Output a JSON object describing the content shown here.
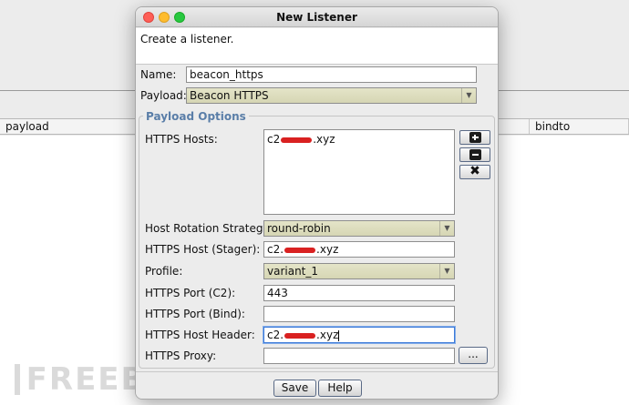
{
  "background": {
    "table": {
      "columns": [
        "payload",
        "bindto"
      ]
    },
    "watermark": "FREEBUF"
  },
  "dialog": {
    "title": "New Listener",
    "description": "Create a listener.",
    "name": {
      "label": "Name:",
      "value": "beacon_https"
    },
    "payload": {
      "label": "Payload:",
      "value": "Beacon HTTPS"
    },
    "group_title": "Payload Options",
    "hosts": {
      "label": "HTTPS Hosts:",
      "items": [
        {
          "prefix": "c2",
          "suffix": ".xyz"
        }
      ],
      "add_button": "add-icon",
      "remove_button": "remove-icon",
      "clear_button": "clear-icon"
    },
    "rotation": {
      "label": "Host Rotation Strategy:",
      "value": "round-robin"
    },
    "stager_host": {
      "label": "HTTPS Host (Stager):",
      "prefix": "c2.",
      "suffix": ".xyz"
    },
    "profile": {
      "label": "Profile:",
      "value": "variant_1"
    },
    "port_c2": {
      "label": "HTTPS Port (C2):",
      "value": "443"
    },
    "port_bind": {
      "label": "HTTPS Port (Bind):",
      "value": ""
    },
    "host_header": {
      "label": "HTTPS Host Header:",
      "prefix": "c2.",
      "suffix": ".xyz"
    },
    "proxy": {
      "label": "HTTPS Proxy:",
      "value": "",
      "button": "..."
    },
    "buttons": {
      "save": "Save",
      "help": "Help"
    }
  },
  "colors": {
    "redaction": "#d92121",
    "group_title": "#5a7ea8",
    "focus": "#3b7ad9"
  }
}
